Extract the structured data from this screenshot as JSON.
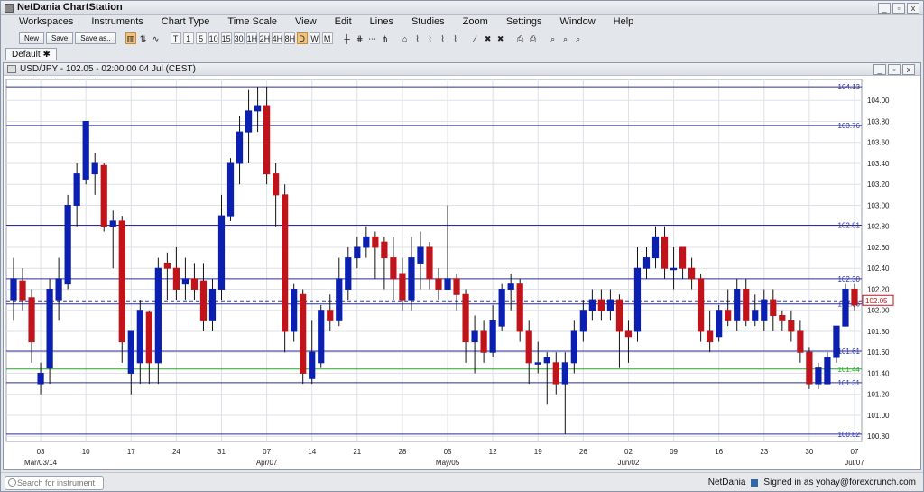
{
  "window": {
    "title": "NetDania ChartStation",
    "min": "_",
    "restore": "▫",
    "close": "x"
  },
  "menu": [
    "Workspaces",
    "Instruments",
    "Chart Type",
    "Time Scale",
    "View",
    "Edit",
    "Lines",
    "Studies",
    "Zoom",
    "Settings",
    "Window",
    "Help"
  ],
  "toolbar": {
    "new_label": "New",
    "save_label": "Save",
    "saveas_label": "Save as..",
    "icons": [
      "▥",
      "⇅",
      "∿",
      "T",
      "1",
      "5",
      "10",
      "15",
      "30",
      "1H",
      "2H",
      "4H",
      "8H",
      "D",
      "W",
      "M",
      "┼",
      "⋕",
      "⋯",
      "⋔",
      "⌂",
      "⌇",
      "⌇",
      "⌇",
      "⌇",
      "∕",
      "✖",
      "✖",
      "⎙",
      "⎙",
      "⌕",
      "⌕",
      "⌕"
    ],
    "timescale_labels": [
      "T",
      "1",
      "5",
      "10",
      "15",
      "30",
      "1H",
      "2H",
      "4H",
      "8H",
      "D",
      "W",
      "M"
    ]
  },
  "tab": {
    "label": "Default",
    "close": "✱"
  },
  "chart_window": {
    "title": "USD/JPY - 102.05 - 02:00:00  04 Jul (CEST)",
    "info": "USD/JPY , Daily, # 93 / 500"
  },
  "colors": {
    "up": "#0b1fb0",
    "down": "#c0141a",
    "hline": "#2b2f9c",
    "green_line": "#2aa22a",
    "current": "#2e3da8",
    "grid": "#dde0e6"
  },
  "chart_data": {
    "type": "candlestick",
    "symbol": "USD/JPY",
    "ylim": [
      100.75,
      104.2
    ],
    "yticks": [
      100.8,
      101.0,
      101.2,
      101.4,
      101.6,
      101.8,
      102.0,
      102.2,
      102.4,
      102.6,
      102.8,
      103.0,
      103.2,
      103.4,
      103.6,
      103.8,
      104.0
    ],
    "xticks": [
      {
        "day": "03",
        "sub": "Mar/03/14",
        "index": 3
      },
      {
        "day": "10",
        "sub": "",
        "index": 8
      },
      {
        "day": "17",
        "sub": "",
        "index": 13
      },
      {
        "day": "24",
        "sub": "",
        "index": 18
      },
      {
        "day": "31",
        "sub": "",
        "index": 23
      },
      {
        "day": "07",
        "sub": "Apr/07",
        "index": 28
      },
      {
        "day": "14",
        "sub": "",
        "index": 33
      },
      {
        "day": "21",
        "sub": "",
        "index": 38
      },
      {
        "day": "28",
        "sub": "",
        "index": 43
      },
      {
        "day": "05",
        "sub": "May/05",
        "index": 48
      },
      {
        "day": "12",
        "sub": "",
        "index": 53
      },
      {
        "day": "19",
        "sub": "",
        "index": 58
      },
      {
        "day": "26",
        "sub": "",
        "index": 63
      },
      {
        "day": "02",
        "sub": "Jun/02",
        "index": 68
      },
      {
        "day": "09",
        "sub": "",
        "index": 73
      },
      {
        "day": "16",
        "sub": "",
        "index": 78
      },
      {
        "day": "23",
        "sub": "",
        "index": 83
      },
      {
        "day": "30",
        "sub": "",
        "index": 88
      },
      {
        "day": "07",
        "sub": "Jul/07",
        "index": 93
      }
    ],
    "hlines": [
      {
        "value": 104.13,
        "label": "104.13",
        "color": "#2b2f9c"
      },
      {
        "value": 103.76,
        "label": "103.76",
        "color": "#2b2f9c"
      },
      {
        "value": 102.81,
        "label": "102.81",
        "color": "#2b2f9c"
      },
      {
        "value": 102.3,
        "label": "102.30",
        "color": "#2b2f9c"
      },
      {
        "value": 102.06,
        "label": "102.06",
        "color": "#2b2f9c"
      },
      {
        "value": 101.61,
        "label": "101.61",
        "color": "#2b2f9c"
      },
      {
        "value": 101.44,
        "label": "101.44",
        "color": "#2aa22a"
      },
      {
        "value": 101.31,
        "label": "101.31",
        "color": "#2b2f9c"
      },
      {
        "value": 100.82,
        "label": "100.82",
        "color": "#2b2f9c"
      }
    ],
    "current": {
      "value": 102.09,
      "label": "102.05"
    },
    "candles": [
      [
        102.1,
        102.3,
        102.5,
        101.9
      ],
      [
        102.28,
        102.1,
        102.4,
        102.0
      ],
      [
        102.12,
        101.7,
        102.2,
        101.5
      ],
      [
        101.3,
        101.4,
        101.5,
        101.2
      ],
      [
        101.45,
        102.2,
        102.3,
        101.3
      ],
      [
        102.1,
        102.3,
        102.5,
        101.9
      ],
      [
        102.25,
        103.0,
        103.1,
        102.2
      ],
      [
        103.0,
        103.3,
        103.4,
        102.8
      ],
      [
        103.25,
        103.8,
        103.8,
        103.2
      ],
      [
        103.3,
        103.4,
        103.5,
        103.1
      ],
      [
        103.38,
        102.8,
        103.4,
        102.75
      ],
      [
        102.8,
        102.85,
        102.95,
        102.4
      ],
      [
        102.85,
        101.7,
        102.9,
        101.5
      ],
      [
        101.4,
        101.8,
        101.8,
        101.2
      ],
      [
        101.5,
        102.0,
        102.1,
        101.3
      ],
      [
        101.98,
        101.5,
        102.0,
        101.3
      ],
      [
        101.5,
        102.4,
        102.5,
        101.3
      ],
      [
        102.45,
        102.4,
        102.55,
        102.1
      ],
      [
        102.4,
        102.2,
        102.6,
        102.1
      ],
      [
        102.25,
        102.3,
        102.5,
        102.1
      ],
      [
        102.3,
        102.2,
        102.45,
        102.1
      ],
      [
        102.28,
        101.9,
        102.45,
        101.8
      ],
      [
        101.9,
        102.2,
        102.3,
        101.8
      ],
      [
        102.2,
        102.9,
        103.1,
        102.1
      ],
      [
        102.9,
        103.4,
        103.45,
        102.85
      ],
      [
        103.4,
        103.7,
        103.85,
        103.2
      ],
      [
        103.7,
        103.9,
        104.1,
        103.4
      ],
      [
        103.9,
        103.95,
        104.13,
        103.7
      ],
      [
        103.95,
        103.3,
        104.13,
        103.2
      ],
      [
        103.3,
        103.1,
        103.4,
        102.8
      ],
      [
        103.1,
        101.8,
        103.2,
        101.6
      ],
      [
        101.8,
        102.2,
        102.25,
        101.7
      ],
      [
        102.15,
        101.4,
        102.2,
        101.3
      ],
      [
        101.35,
        101.6,
        101.9,
        101.3
      ],
      [
        101.5,
        102.0,
        102.05,
        101.45
      ],
      [
        102.0,
        101.9,
        102.15,
        101.8
      ],
      [
        101.9,
        102.3,
        102.5,
        101.85
      ],
      [
        102.2,
        102.5,
        102.6,
        102.1
      ],
      [
        102.5,
        102.6,
        102.7,
        102.4
      ],
      [
        102.6,
        102.7,
        102.8,
        102.5
      ],
      [
        102.7,
        102.6,
        102.75,
        102.3
      ],
      [
        102.65,
        102.5,
        102.7,
        102.2
      ],
      [
        102.5,
        102.3,
        102.7,
        102.1
      ],
      [
        102.35,
        102.1,
        102.5,
        102.0
      ],
      [
        102.1,
        102.5,
        102.7,
        102.0
      ],
      [
        102.45,
        102.6,
        102.75,
        102.2
      ],
      [
        102.6,
        102.3,
        102.65,
        102.2
      ],
      [
        102.3,
        102.2,
        102.4,
        102.1
      ],
      [
        102.2,
        102.3,
        103.0,
        102.2
      ],
      [
        102.3,
        102.15,
        102.35,
        102.0
      ],
      [
        102.15,
        101.7,
        102.2,
        101.5
      ],
      [
        101.7,
        101.8,
        101.95,
        101.4
      ],
      [
        101.8,
        101.6,
        101.9,
        101.5
      ],
      [
        101.6,
        101.9,
        102.05,
        101.55
      ],
      [
        101.85,
        102.2,
        102.25,
        101.8
      ],
      [
        102.2,
        102.25,
        102.35,
        102.0
      ],
      [
        102.25,
        101.8,
        102.3,
        101.7
      ],
      [
        101.8,
        101.5,
        101.9,
        101.3
      ],
      [
        101.5,
        101.5,
        101.7,
        101.4
      ],
      [
        101.5,
        101.55,
        101.6,
        101.1
      ],
      [
        101.5,
        101.3,
        101.6,
        101.2
      ],
      [
        101.3,
        101.5,
        101.6,
        100.82
      ],
      [
        101.5,
        101.8,
        101.9,
        101.4
      ],
      [
        101.8,
        102.0,
        102.1,
        101.7
      ],
      [
        102.0,
        102.1,
        102.2,
        101.9
      ],
      [
        102.1,
        102.0,
        102.2,
        101.9
      ],
      [
        102.0,
        102.1,
        102.2,
        101.9
      ],
      [
        102.1,
        101.8,
        102.15,
        101.45
      ],
      [
        101.8,
        101.75,
        101.9,
        101.5
      ],
      [
        101.8,
        102.4,
        102.6,
        101.7
      ],
      [
        102.4,
        102.5,
        102.6,
        102.3
      ],
      [
        102.5,
        102.7,
        102.8,
        102.4
      ],
      [
        102.7,
        102.4,
        102.8,
        102.3
      ],
      [
        102.4,
        102.4,
        102.6,
        102.2
      ],
      [
        102.6,
        102.4,
        102.6,
        102.3
      ],
      [
        102.4,
        102.3,
        102.5,
        102.2
      ],
      [
        102.3,
        101.8,
        102.35,
        101.7
      ],
      [
        101.8,
        101.7,
        102.0,
        101.6
      ],
      [
        101.75,
        102.0,
        102.05,
        101.7
      ],
      [
        102.0,
        101.9,
        102.2,
        101.85
      ],
      [
        101.9,
        102.2,
        102.3,
        101.8
      ],
      [
        102.2,
        101.9,
        102.3,
        101.85
      ],
      [
        101.9,
        102.0,
        102.15,
        101.85
      ],
      [
        101.9,
        102.1,
        102.2,
        101.8
      ],
      [
        102.1,
        101.95,
        102.2,
        101.8
      ],
      [
        101.95,
        101.9,
        102.0,
        101.8
      ],
      [
        101.9,
        101.8,
        102.0,
        101.7
      ],
      [
        101.8,
        101.6,
        101.9,
        101.5
      ],
      [
        101.6,
        101.3,
        101.65,
        101.25
      ],
      [
        101.3,
        101.45,
        101.5,
        101.25
      ],
      [
        101.3,
        101.55,
        101.6,
        101.3
      ],
      [
        101.55,
        101.85,
        101.85,
        101.5
      ],
      [
        101.85,
        102.2,
        102.25,
        101.85
      ],
      [
        102.2,
        102.05,
        102.25,
        102.0
      ]
    ]
  }
}
